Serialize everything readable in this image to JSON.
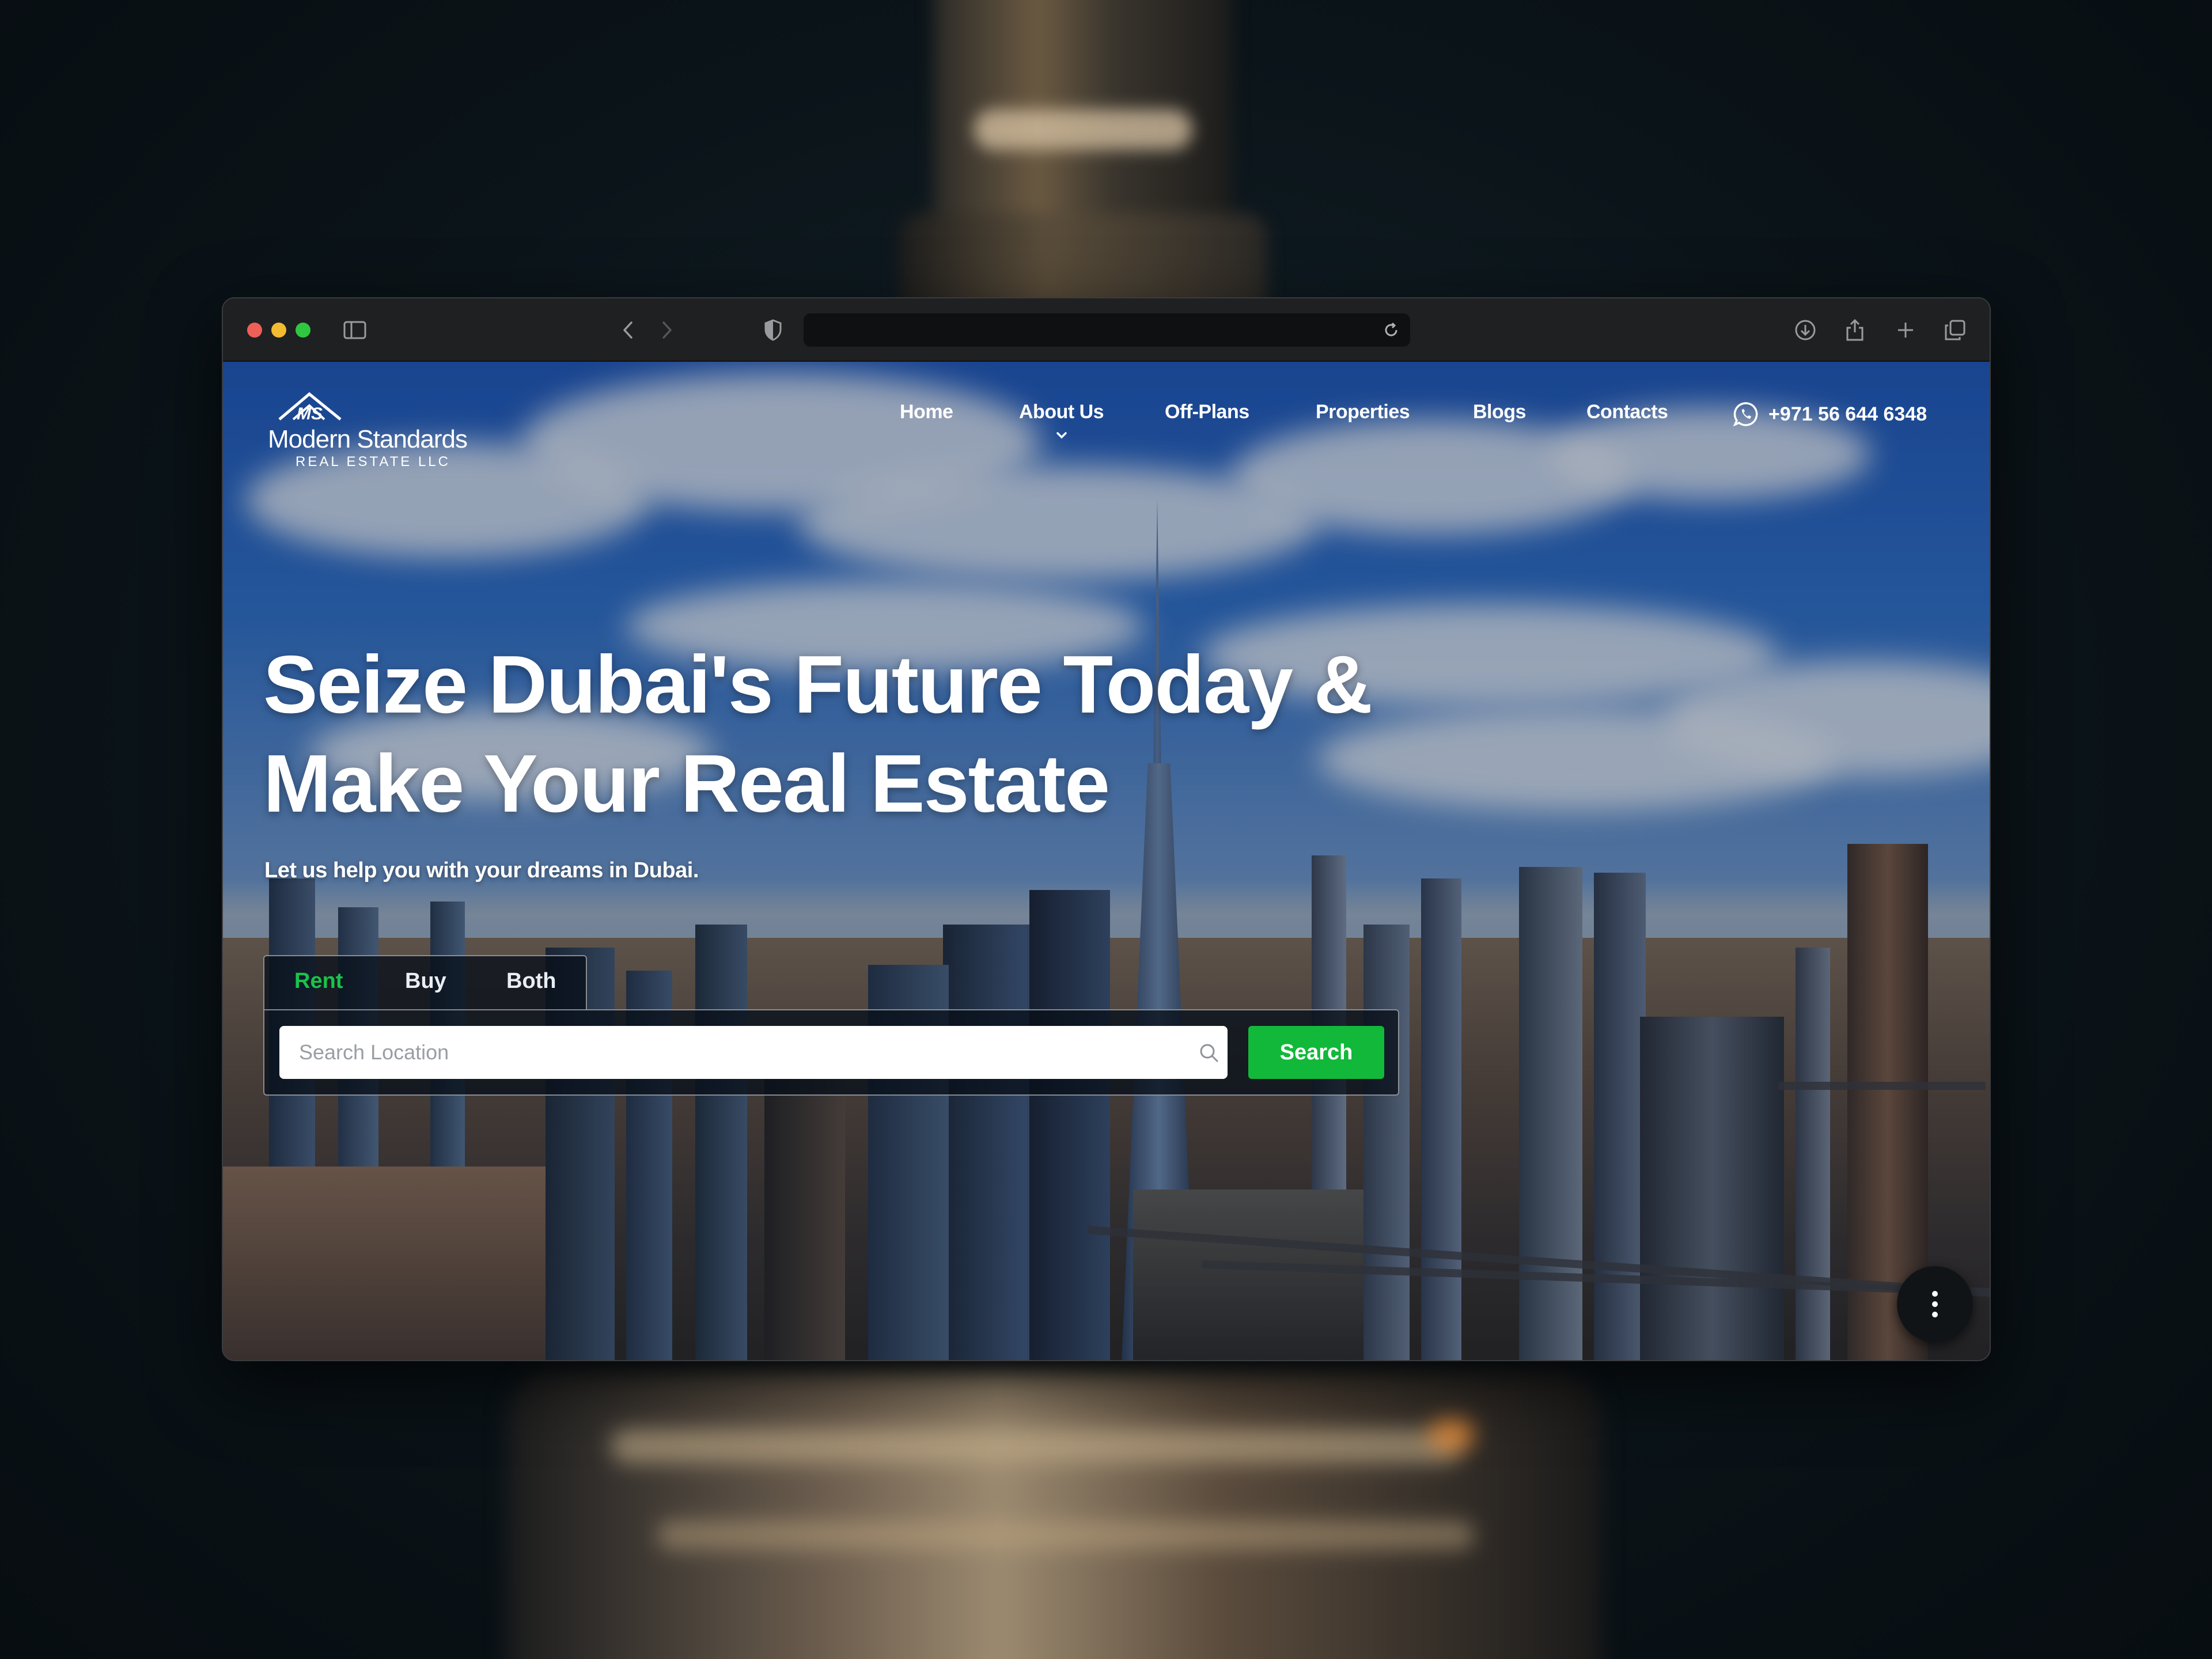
{
  "browser": {
    "url": ""
  },
  "logo": {
    "name": "Modern Standards",
    "subtitle": "REAL ESTATE LLC",
    "mark": "MS"
  },
  "nav": {
    "items": [
      {
        "label": "Home"
      },
      {
        "label": "About Us"
      },
      {
        "label": "Off-Plans"
      },
      {
        "label": "Properties"
      },
      {
        "label": "Blogs"
      },
      {
        "label": "Contacts"
      }
    ],
    "phone": "+971 56 644 6348"
  },
  "hero": {
    "title_line1": "Seize Dubai's Future Today &",
    "title_line2": "Make Your Real Estate",
    "subtitle": "Let us help you with your dreams in Dubai."
  },
  "search": {
    "tabs": [
      {
        "label": "Rent",
        "active": true
      },
      {
        "label": "Buy",
        "active": false
      },
      {
        "label": "Both",
        "active": false
      }
    ],
    "placeholder": "Search Location",
    "button_label": "Search"
  },
  "colors": {
    "accent_green": "#12b83a",
    "active_tab": "#19c34b",
    "traffic_red": "#ee5f57",
    "traffic_yellow": "#f3bb2f",
    "traffic_green": "#2fc640"
  }
}
